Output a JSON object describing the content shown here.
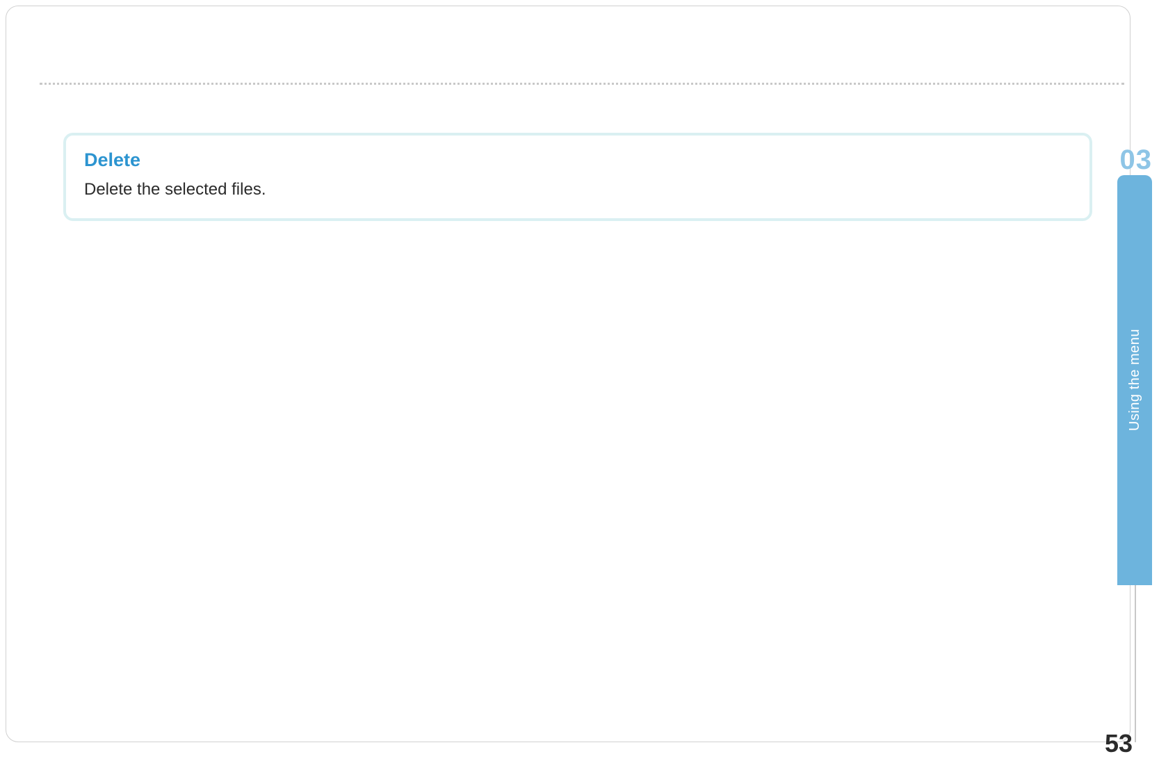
{
  "info_box": {
    "title": "Delete",
    "description": "Delete the selected files."
  },
  "chapter": {
    "number": "03",
    "label": "Using the menu"
  },
  "page_number": "53"
}
